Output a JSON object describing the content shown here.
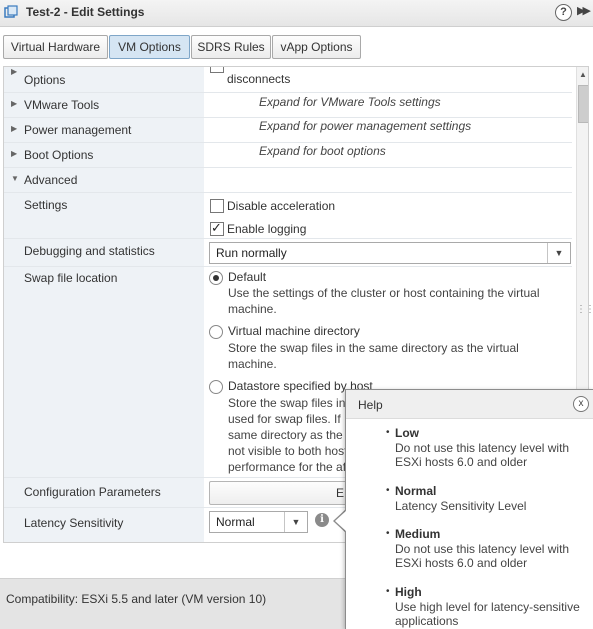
{
  "window": {
    "title": "Test-2 - Edit Settings",
    "help_glyph": "?",
    "expand_glyph": "▶▶"
  },
  "tabs": [
    {
      "label": "Virtual Hardware",
      "active": false
    },
    {
      "label": "VM Options",
      "active": true
    },
    {
      "label": "SDRS Rules",
      "active": false
    },
    {
      "label": "vApp Options",
      "active": false
    }
  ],
  "settings": {
    "console_options_label": "Options",
    "console_partial_text": "disconnects",
    "vmware_tools": {
      "label": "VMware Tools",
      "hint": "Expand for VMware Tools settings"
    },
    "power_management": {
      "label": "Power management",
      "hint": "Expand for power management settings"
    },
    "boot_options": {
      "label": "Boot Options",
      "hint": "Expand for boot options"
    },
    "advanced": {
      "label": "Advanced",
      "settings_label": "Settings",
      "disable_acceleration": {
        "label": "Disable acceleration",
        "checked": false
      },
      "enable_logging": {
        "label": "Enable logging",
        "checked": true
      },
      "debugging_label": "Debugging and statistics",
      "debugging_value": "Run normally",
      "swap_label": "Swap file location",
      "swap_options": [
        {
          "label": "Default",
          "desc1": "Use the settings of the cluster or host containing the virtual",
          "desc2": "machine.",
          "selected": true
        },
        {
          "label": "Virtual machine directory",
          "desc1": "Store the swap files in the same directory as the virtual",
          "desc2": "machine.",
          "selected": false
        },
        {
          "label": "Datastore specified by host",
          "desc_lines": [
            "Store the swap files in",
            "used for swap files. If",
            "same directory as the",
            "not visible to both host",
            "performance for the af"
          ],
          "selected": false
        }
      ],
      "config_params_label": "Configuration Parameters",
      "config_params_button": "E",
      "latency_label": "Latency Sensitivity",
      "latency_value": "Normal"
    }
  },
  "footer": {
    "compatibility": "Compatibility: ESXi 5.5 and later (VM version 10)"
  },
  "help": {
    "title": "Help",
    "close_glyph": "x",
    "items": [
      {
        "name": "Low",
        "desc": "Do not use this latency level with ESXi hosts 6.0 and older"
      },
      {
        "name": "Normal",
        "desc": "Latency Sensitivity Level"
      },
      {
        "name": "Medium",
        "desc": "Do not use this latency level with ESXi hosts 6.0 and older"
      },
      {
        "name": "High",
        "desc": "Use high level for latency-sensitive applications"
      }
    ]
  }
}
